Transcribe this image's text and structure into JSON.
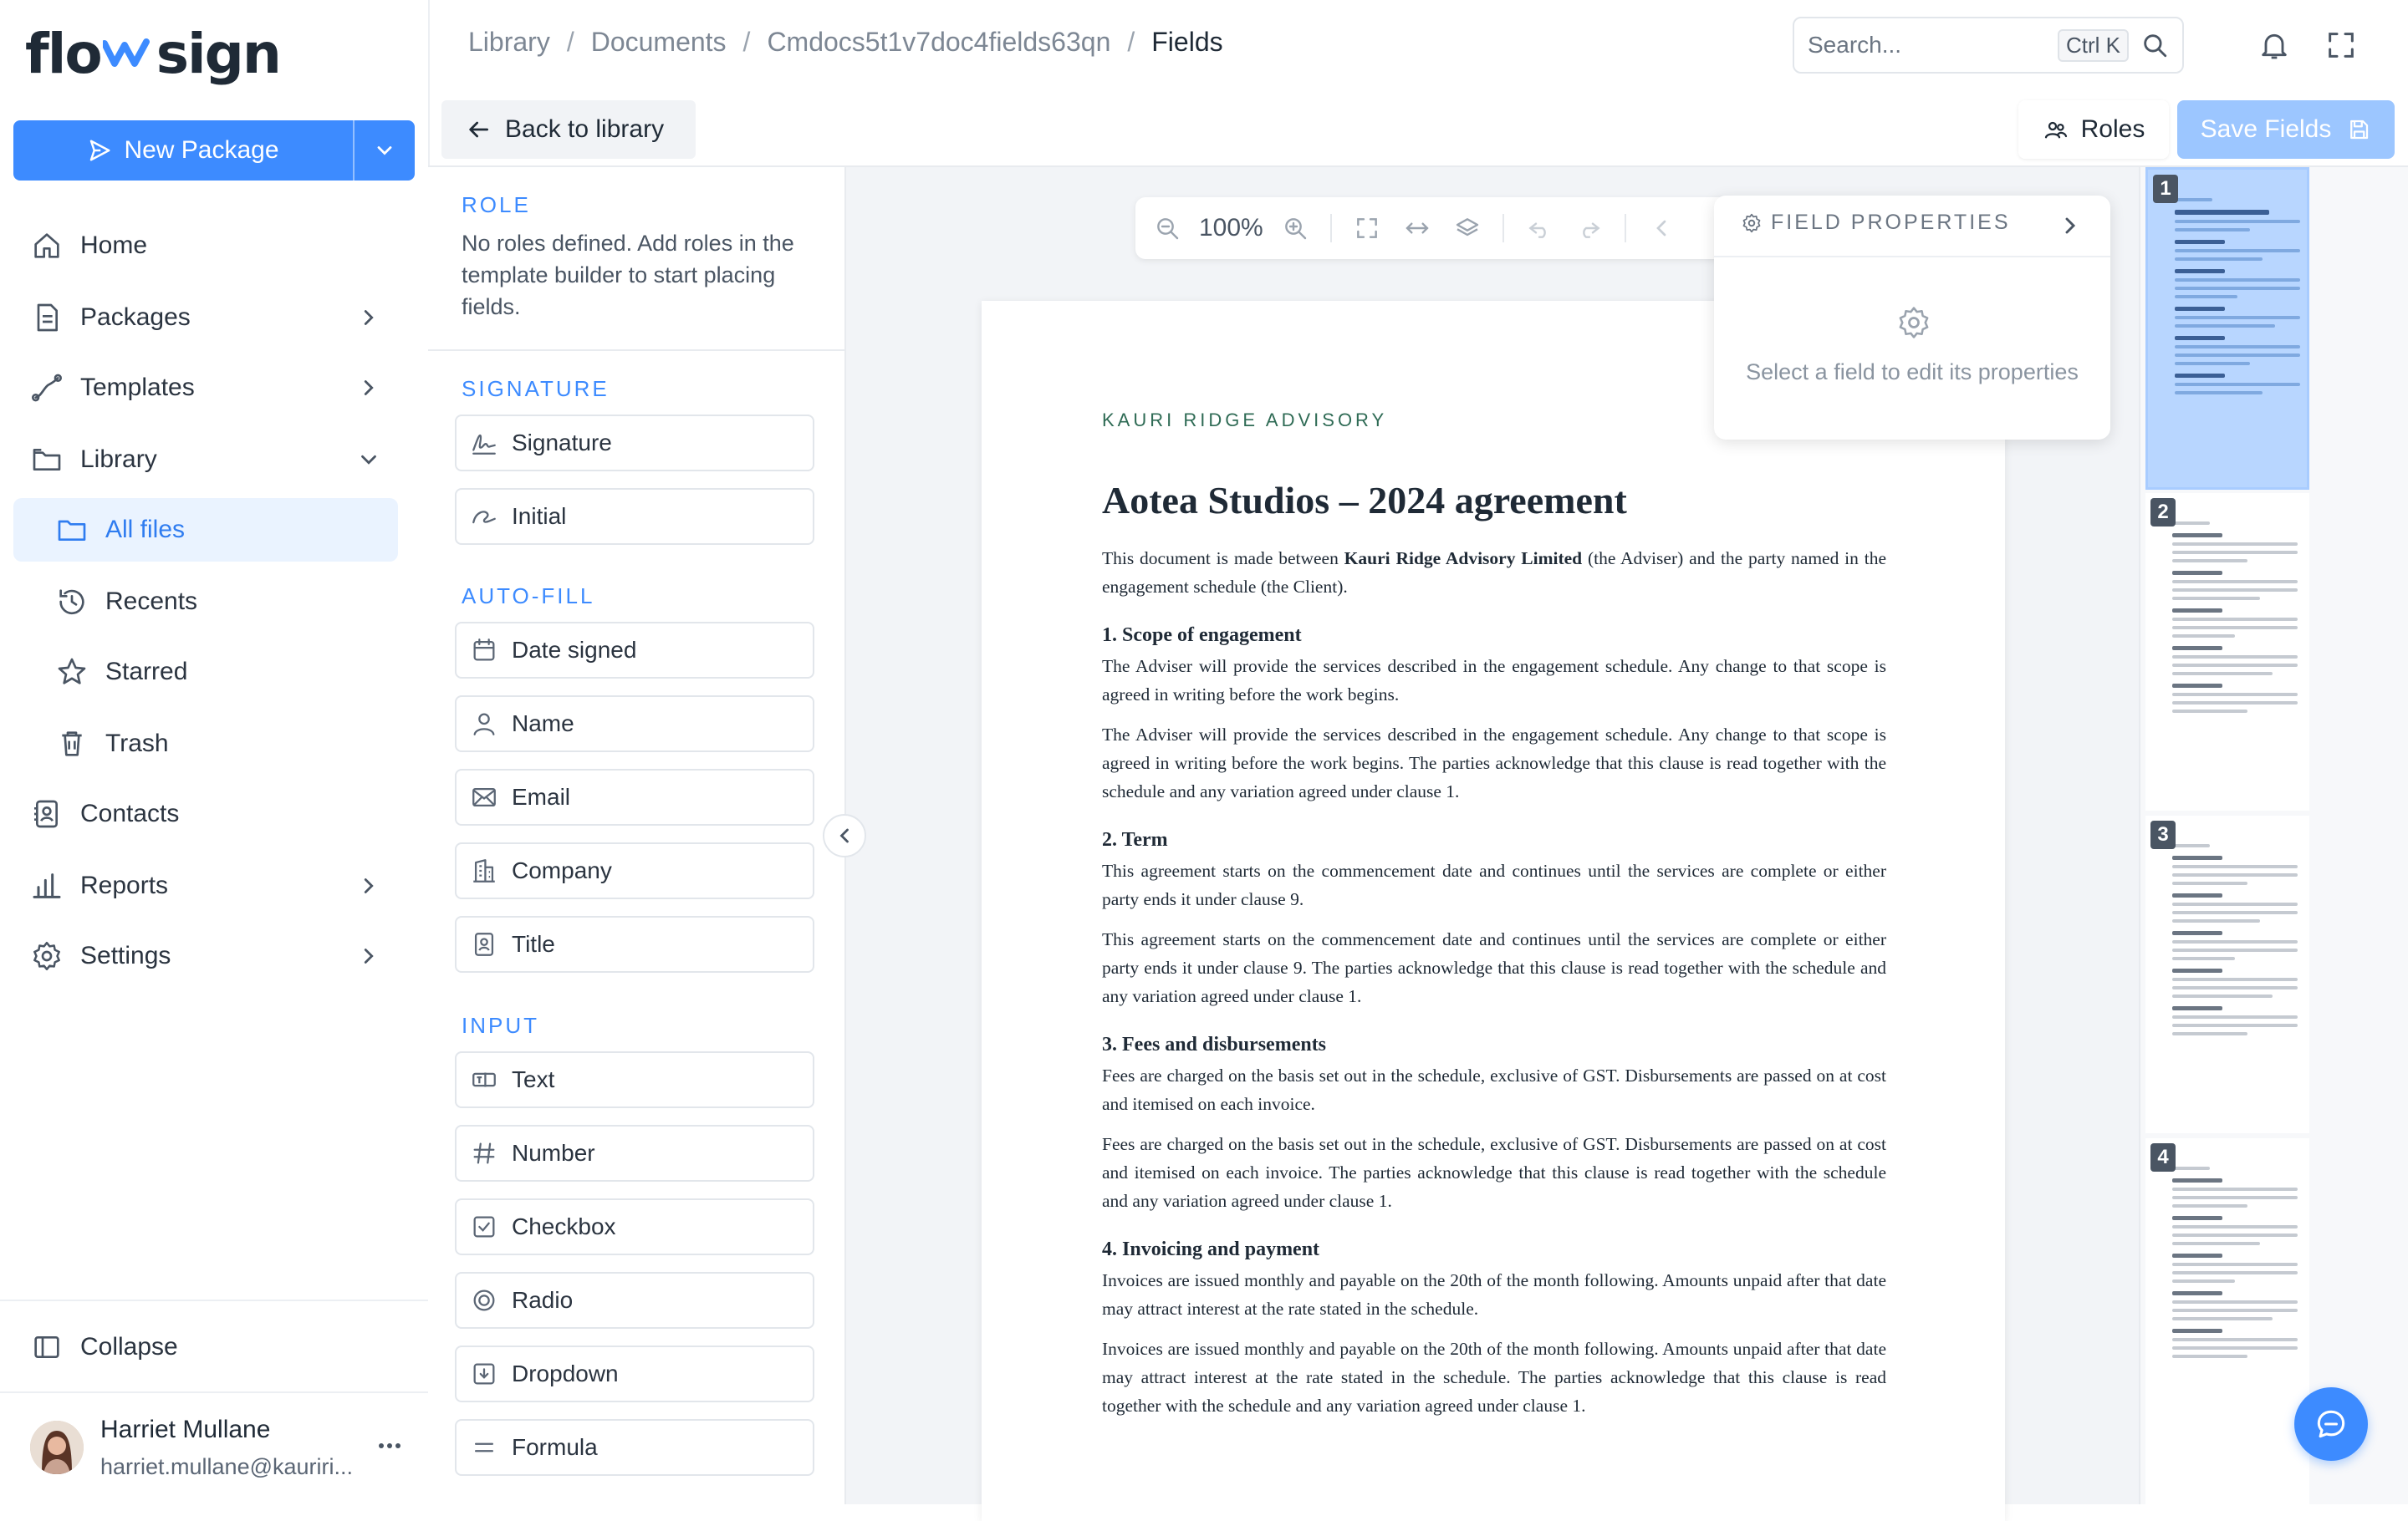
{
  "app": {
    "logo_left": "flo",
    "logo_right": "sign",
    "brand_color": "#3d8bff"
  },
  "sidebar": {
    "new_package_label": "New Package",
    "items": [
      {
        "label": "Home",
        "icon": "home-icon"
      },
      {
        "label": "Packages",
        "icon": "package-icon"
      },
      {
        "label": "Templates",
        "icon": "templates-icon"
      },
      {
        "label": "Library",
        "icon": "folder-icon"
      },
      {
        "label": "All files",
        "icon": "folder-icon"
      },
      {
        "label": "Recents",
        "icon": "history-icon"
      },
      {
        "label": "Starred",
        "icon": "star-icon"
      },
      {
        "label": "Trash",
        "icon": "trash-icon"
      },
      {
        "label": "Contacts",
        "icon": "contacts-icon"
      },
      {
        "label": "Reports",
        "icon": "chart-icon"
      },
      {
        "label": "Settings",
        "icon": "gear-icon"
      }
    ],
    "collapse_label": "Collapse",
    "user": {
      "name": "Harriet Mullane",
      "email": "harriet.mullane@kauriri..."
    }
  },
  "header": {
    "breadcrumb": [
      "Library",
      "Documents",
      "Cmdocs5t1v7doc4fields63qn",
      "Fields"
    ],
    "search_placeholder": "Search...",
    "search_shortcut": "Ctrl K"
  },
  "toolbar": {
    "back_label": "Back to library",
    "roles_label": "Roles",
    "save_label": "Save Fields"
  },
  "palette": {
    "role_title": "ROLE",
    "role_text": "No roles defined. Add roles in the template builder to start placing fields.",
    "signature_title": "SIGNATURE",
    "signature_fields": [
      "Signature",
      "Initial"
    ],
    "autofill_title": "AUTO-FILL",
    "autofill_fields": [
      "Date signed",
      "Name",
      "Email",
      "Company",
      "Title"
    ],
    "input_title": "INPUT",
    "input_fields": [
      "Text",
      "Number",
      "Checkbox",
      "Radio",
      "Dropdown",
      "Formula"
    ]
  },
  "viewer": {
    "zoom": "100%"
  },
  "field_properties": {
    "title": "FIELD PROPERTIES",
    "empty_text": "Select a field to edit its properties"
  },
  "document": {
    "company": "KAURI RIDGE ADVISORY",
    "title": "Aotea Studios – 2024 agreement",
    "intro_before": "This document is made between ",
    "intro_bold": "Kauri Ridge Advisory Limited",
    "intro_after": " (the Adviser) and the party named in the engagement schedule (the Client).",
    "sections": [
      {
        "heading": "1. Scope of engagement",
        "p1": "The Adviser will provide the services described in the engagement schedule. Any change to that scope is agreed in writing before the work begins.",
        "p2": "The Adviser will provide the services described in the engagement schedule. Any change to that scope is agreed in writing before the work begins. The parties acknowledge that this clause is read together with the schedule and any variation agreed under clause 1."
      },
      {
        "heading": "2. Term",
        "p1": "This agreement starts on the commencement date and continues until the services are complete or either party ends it under clause 9.",
        "p2": "This agreement starts on the commencement date and continues until the services are complete or either party ends it under clause 9. The parties acknowledge that this clause is read together with the schedule and any variation agreed under clause 1."
      },
      {
        "heading": "3. Fees and disbursements",
        "p1": "Fees are charged on the basis set out in the schedule, exclusive of GST. Disbursements are passed on at cost and itemised on each invoice.",
        "p2": "Fees are charged on the basis set out in the schedule, exclusive of GST. Disbursements are passed on at cost and itemised on each invoice. The parties acknowledge that this clause is read together with the schedule and any variation agreed under clause 1."
      },
      {
        "heading": "4. Invoicing and payment",
        "p1": "Invoices are issued monthly and payable on the 20th of the month following. Amounts unpaid after that date may attract interest at the rate stated in the schedule.",
        "p2": "Invoices are issued monthly and payable on the 20th of the month following. Amounts unpaid after that date may attract interest at the rate stated in the schedule. The parties acknowledge that this clause is read together with the schedule and any variation agreed under clause 1."
      }
    ]
  },
  "thumbnails": [
    "1",
    "2",
    "3",
    "4"
  ]
}
